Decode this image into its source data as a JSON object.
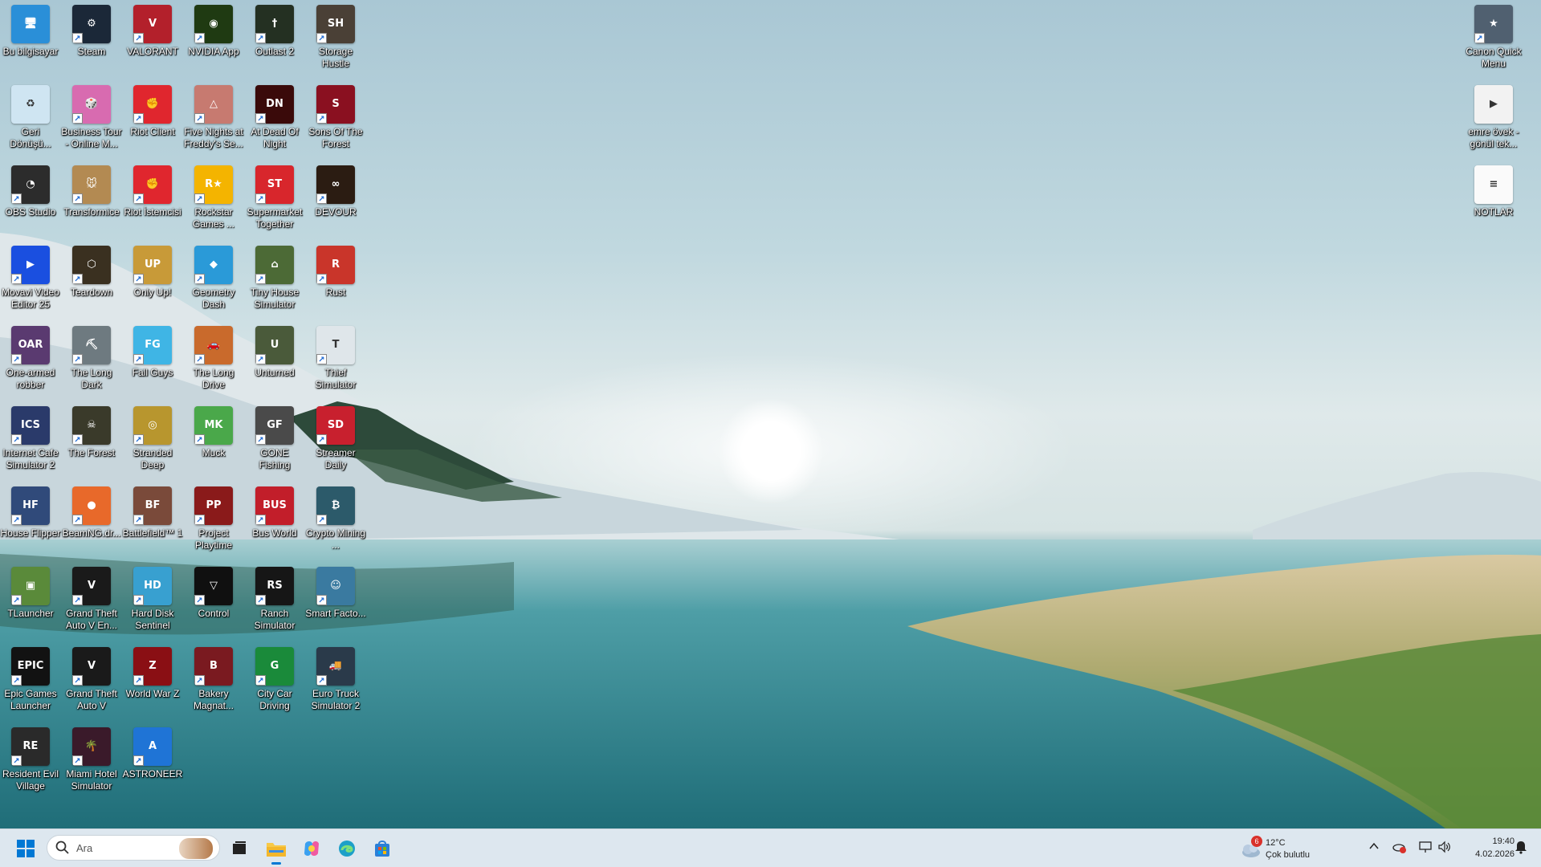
{
  "desktop_icons": [
    {
      "label": "Bu bilgisayar",
      "color": "#2a8fd8",
      "glyph": "🖥",
      "shortcut": false
    },
    {
      "label": "Steam",
      "color": "#1b2838",
      "glyph": "⚙",
      "shortcut": true
    },
    {
      "label": "VALORANT",
      "color": "#b3202b",
      "glyph": "V",
      "shortcut": true
    },
    {
      "label": "NVIDIA App",
      "color": "#1f3a12",
      "glyph": "◉",
      "shortcut": true
    },
    {
      "label": "Outlast 2",
      "color": "#243022",
      "glyph": "†",
      "shortcut": true
    },
    {
      "label": "Storage Hustle",
      "color": "#4a4036",
      "glyph": "SH",
      "shortcut": true
    },
    {
      "label": "Geri Dönüşü...",
      "color": "#cfe5f2",
      "glyph": "♻",
      "shortcut": false
    },
    {
      "label": "Business Tour - Online M...",
      "color": "#d86bb0",
      "glyph": "🎲",
      "shortcut": true
    },
    {
      "label": "Riot Client",
      "color": "#e0262e",
      "glyph": "✊",
      "shortcut": true
    },
    {
      "label": "Five Nights at Freddy's Se...",
      "color": "#c77a70",
      "glyph": "△",
      "shortcut": true
    },
    {
      "label": "At Dead Of Night",
      "color": "#3a0a0a",
      "glyph": "DN",
      "shortcut": true
    },
    {
      "label": "Sons Of The Forest",
      "color": "#8a1020",
      "glyph": "S",
      "shortcut": true
    },
    {
      "label": "OBS Studio",
      "color": "#2c2c2c",
      "glyph": "◔",
      "shortcut": true
    },
    {
      "label": "Transformice",
      "color": "#b38a52",
      "glyph": "🐭",
      "shortcut": true
    },
    {
      "label": "Riot İstemcisi",
      "color": "#e0262e",
      "glyph": "✊",
      "shortcut": true
    },
    {
      "label": "Rockstar Games ...",
      "color": "#f4b400",
      "glyph": "R★",
      "shortcut": true
    },
    {
      "label": "Supermarket Together",
      "color": "#d8262c",
      "glyph": "ST",
      "shortcut": true
    },
    {
      "label": "DEVOUR",
      "color": "#2b1c12",
      "glyph": "∞",
      "shortcut": true
    },
    {
      "label": "Movavi Video Editor 25",
      "color": "#1a4fe0",
      "glyph": "▶",
      "shortcut": true
    },
    {
      "label": "Teardown",
      "color": "#3a3020",
      "glyph": "⬡",
      "shortcut": true
    },
    {
      "label": "Only Up!",
      "color": "#c89a38",
      "glyph": "UP",
      "shortcut": true
    },
    {
      "label": "Geometry Dash",
      "color": "#2a9ad8",
      "glyph": "◆",
      "shortcut": true
    },
    {
      "label": "Tiny House Simulator",
      "color": "#4c6a36",
      "glyph": "⌂",
      "shortcut": true
    },
    {
      "label": "Rust",
      "color": "#c9352a",
      "glyph": "R",
      "shortcut": true
    },
    {
      "label": "One-armed robber",
      "color": "#5a3a70",
      "glyph": "OAR",
      "shortcut": true
    },
    {
      "label": "The Long Dark",
      "color": "#6e7a80",
      "glyph": "⛏",
      "shortcut": true
    },
    {
      "label": "Fall Guys",
      "color": "#3fb5e5",
      "glyph": "FG",
      "shortcut": true
    },
    {
      "label": "The Long Drive",
      "color": "#c96a2c",
      "glyph": "🚗",
      "shortcut": true
    },
    {
      "label": "Unturned",
      "color": "#4a5a3a",
      "glyph": "U",
      "shortcut": true
    },
    {
      "label": "Thief Simulator",
      "color": "#dfe6ea",
      "glyph": "T",
      "shortcut": true
    },
    {
      "label": "Internet Cafe Simulator 2",
      "color": "#2a3a6a",
      "glyph": "ICS",
      "shortcut": true
    },
    {
      "label": "The Forest",
      "color": "#3a3a2a",
      "glyph": "☠",
      "shortcut": true
    },
    {
      "label": "Stranded Deep",
      "color": "#b8962e",
      "glyph": "◎",
      "shortcut": true
    },
    {
      "label": "Muck",
      "color": "#4aa84a",
      "glyph": "MK",
      "shortcut": true
    },
    {
      "label": "GONE Fishing",
      "color": "#4a4a4a",
      "glyph": "GF",
      "shortcut": true
    },
    {
      "label": "Streamer Daily",
      "color": "#c8202e",
      "glyph": "SD",
      "shortcut": true
    },
    {
      "label": "House Flipper",
      "color": "#304a7a",
      "glyph": "HF",
      "shortcut": true
    },
    {
      "label": "BeamNG.dr...",
      "color": "#e8692a",
      "glyph": "●",
      "shortcut": true
    },
    {
      "label": "Battlefield™ 1",
      "color": "#7a4a3a",
      "glyph": "BF",
      "shortcut": true
    },
    {
      "label": "Project Playtime",
      "color": "#8a1a1a",
      "glyph": "PP",
      "shortcut": true
    },
    {
      "label": "Bus World",
      "color": "#c21e2a",
      "glyph": "BUS",
      "shortcut": true
    },
    {
      "label": "Crypto Mining ...",
      "color": "#2c5a6a",
      "glyph": "₿",
      "shortcut": true
    },
    {
      "label": "TLauncher",
      "color": "#5a8a3a",
      "glyph": "▣",
      "shortcut": true
    },
    {
      "label": "Grand Theft Auto V En...",
      "color": "#1a1a1a",
      "glyph": "V",
      "shortcut": true
    },
    {
      "label": "Hard Disk Sentinel",
      "color": "#38a0d0",
      "glyph": "HD",
      "shortcut": true
    },
    {
      "label": "Control",
      "color": "#101010",
      "glyph": "▽",
      "shortcut": true
    },
    {
      "label": "Ranch Simulator",
      "color": "#161616",
      "glyph": "RS",
      "shortcut": true
    },
    {
      "label": "Smart Facto...",
      "color": "#3a7aa0",
      "glyph": "☺",
      "shortcut": true
    },
    {
      "label": "Epic Games Launcher",
      "color": "#121212",
      "glyph": "EPIC",
      "shortcut": true
    },
    {
      "label": "Grand Theft Auto V",
      "color": "#1a1a1a",
      "glyph": "V",
      "shortcut": true
    },
    {
      "label": "World War Z",
      "color": "#8a0f14",
      "glyph": "Z",
      "shortcut": true
    },
    {
      "label": "Bakery Magnat...",
      "color": "#7a1a20",
      "glyph": "B",
      "shortcut": true
    },
    {
      "label": "City Car Driving",
      "color": "#1a8a3a",
      "glyph": "G",
      "shortcut": true
    },
    {
      "label": "Euro Truck Simulator 2",
      "color": "#2a3a4a",
      "glyph": "🚚",
      "shortcut": true
    },
    {
      "label": "Resident Evil Village",
      "color": "#2a2a2a",
      "glyph": "RE",
      "shortcut": true
    },
    {
      "label": "Miami Hotel Simulator",
      "color": "#3a1a2a",
      "glyph": "🌴",
      "shortcut": true
    },
    {
      "label": "ASTRONEER",
      "color": "#1f74d6",
      "glyph": "A",
      "shortcut": true
    }
  ],
  "right_icons": [
    {
      "label": "Canon Quick Menu",
      "color": "#506070",
      "glyph": "★",
      "shortcut": true
    },
    {
      "label": "emre övek - gönül tek...",
      "color": "#f2f2f2",
      "glyph": "▶",
      "shortcut": false
    },
    {
      "label": "NOTLAR",
      "color": "#fafafa",
      "glyph": "≡",
      "shortcut": false
    }
  ],
  "taskbar": {
    "search_placeholder": "Ara",
    "weather_temp": "12°C",
    "weather_desc": "Çok bulutlu",
    "weather_badge": "6",
    "time": "19:40",
    "date": "4.02.2026"
  },
  "colors": {
    "taskbar_bg": "#dde7ef",
    "windows_blue": "#0078d4"
  }
}
